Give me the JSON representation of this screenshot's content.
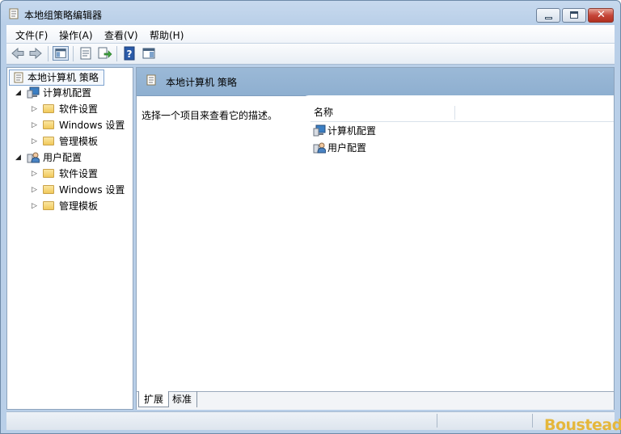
{
  "window": {
    "title": "本地组策略编辑器"
  },
  "menu": [
    {
      "label": "文件(F)"
    },
    {
      "label": "操作(A)"
    },
    {
      "label": "查看(V)"
    },
    {
      "label": "帮助(H)"
    }
  ],
  "toolbar": {
    "buttons": [
      "back-icon",
      "forward-icon",
      "show-hide-tree-icon",
      "properties-icon",
      "export-list-icon",
      "help-icon",
      "show-hide-action-pane-icon"
    ]
  },
  "tree": {
    "root": "本地计算机 策略",
    "computer": {
      "label": "计算机配置",
      "children": [
        "软件设置",
        "Windows 设置",
        "管理模板"
      ]
    },
    "user": {
      "label": "用户配置",
      "children": [
        "软件设置",
        "Windows 设置",
        "管理模板"
      ]
    }
  },
  "right": {
    "header": "本地计算机 策略",
    "description": "选择一个项目来查看它的描述。",
    "column_name": "名称",
    "items": [
      "计算机配置",
      "用户配置"
    ],
    "tabs": {
      "extended": "扩展",
      "standard": "标准"
    }
  },
  "watermark": "Boustead",
  "colors": {
    "header_blue": "#9bb9d7",
    "chrome_blue": "#b9cfe8",
    "watermark_gold": "#e5b73b"
  }
}
